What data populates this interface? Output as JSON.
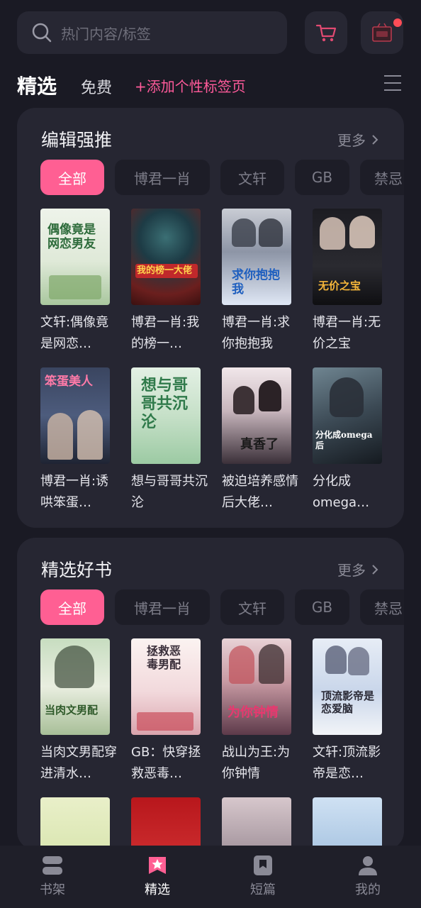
{
  "search": {
    "placeholder": "热门内容/标签"
  },
  "tabs": {
    "selected": "精选",
    "free": "免费",
    "add": "+添加个性标签页"
  },
  "accent_color": "#ff5f93",
  "sections": [
    {
      "title": "编辑强推",
      "more": "更多",
      "chips": [
        "全部",
        "博君一肖",
        "文轩",
        "GB",
        "禁忌"
      ],
      "books": [
        {
          "title": "文轩:偶像竟是网恋…",
          "cover_text": "偶像竟是网恋男友"
        },
        {
          "title": "博君一肖:我的榜一…",
          "cover_text": "我的榜一大佬"
        },
        {
          "title": "博君一肖:求你抱抱我",
          "cover_text": "求你抱抱我"
        },
        {
          "title": "博君一肖:无价之宝",
          "cover_text": "无价之宝"
        },
        {
          "title": "博君一肖:诱哄笨蛋…",
          "cover_text": "笨蛋美人"
        },
        {
          "title": "想与哥哥共沉沦",
          "cover_text": "想与哥哥共沉沦"
        },
        {
          "title": "被迫培养感情后大佬…",
          "cover_text": "真香了"
        },
        {
          "title": "分化成omega…",
          "cover_text": "分化成omega后"
        }
      ]
    },
    {
      "title": "精选好书",
      "more": "更多",
      "chips": [
        "全部",
        "博君一肖",
        "文轩",
        "GB",
        "禁忌"
      ],
      "books": [
        {
          "title": "当肉文男配穿进清水…",
          "cover_text": "当肉文男配"
        },
        {
          "title": "GB：快穿拯救恶毒…",
          "cover_text": "拯救恶毒男配"
        },
        {
          "title": "战山为王:为你钟情",
          "cover_text": "为你钟情"
        },
        {
          "title": "文轩:顶流影帝是恋…",
          "cover_text": "顶流影帝是恋爱脑"
        },
        {
          "title": "",
          "cover_text": ""
        },
        {
          "title": "",
          "cover_text": ""
        },
        {
          "title": "",
          "cover_text": ""
        },
        {
          "title": "",
          "cover_text": ""
        }
      ]
    }
  ],
  "nav": [
    {
      "label": "书架",
      "icon": "bookshelf-icon"
    },
    {
      "label": "精选",
      "icon": "star-icon",
      "active": true
    },
    {
      "label": "短篇",
      "icon": "bookmark-icon"
    },
    {
      "label": "我的",
      "icon": "user-icon"
    }
  ]
}
